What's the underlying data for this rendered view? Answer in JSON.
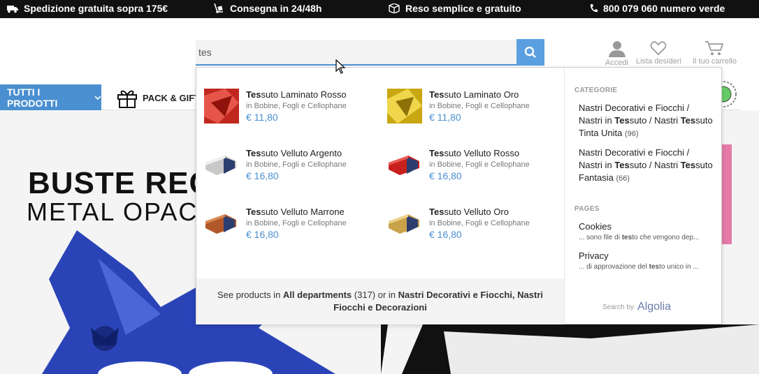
{
  "topbar": {
    "shipping": "Spedizione gratuita sopra 175€",
    "delivery": "Consegna in 24/48h",
    "returns": "Reso semplice e gratuito",
    "phone": "800 079 060 numero verde"
  },
  "search": {
    "value": "tes"
  },
  "header": {
    "account": "Accedi",
    "wishlist": "Lista desideri",
    "cart": "Il tuo carrello"
  },
  "nav": {
    "all_products": "TUTTI I PRODOTTI",
    "pack_gift": "PACK & GIFT"
  },
  "hero": {
    "title1": "BUSTE REGA",
    "title2": "METAL OPACO"
  },
  "dropdown": {
    "products": [
      {
        "highlight": "Tes",
        "rest": "suto Laminato Rosso",
        "category": "in Bobine, Fogli e Cellophane",
        "price": "€ 11,80"
      },
      {
        "highlight": "Tes",
        "rest": "suto Laminato Oro",
        "category": "in Bobine, Fogli e Cellophane",
        "price": "€ 11,80"
      },
      {
        "highlight": "Tes",
        "rest": "suto Velluto Argento",
        "category": "in Bobine, Fogli e Cellophane",
        "price": "€ 16,80"
      },
      {
        "highlight": "Tes",
        "rest": "suto Velluto Rosso",
        "category": "in Bobine, Fogli e Cellophane",
        "price": "€ 16,80"
      },
      {
        "highlight": "Tes",
        "rest": "suto Velluto Marrone",
        "category": "in Bobine, Fogli e Cellophane",
        "price": "€ 16,80"
      },
      {
        "highlight": "Tes",
        "rest": "suto Velluto Oro",
        "category": "in Bobine, Fogli e Cellophane",
        "price": "€ 16,80"
      }
    ],
    "footer": {
      "prefix": "See products in ",
      "all_departments": "All departments",
      "count": " (317) or in ",
      "category": "Nastri Decorativi e Fiocchi, Nastri Fiocchi e Decorazioni"
    },
    "categories_header": "CATEGORIE",
    "categories": [
      {
        "pre": "Nastri Decorativi e Fiocchi / Nastri in ",
        "hl1": "Tes",
        "mid": "suto / Nastri ",
        "hl2": "Tes",
        "post": "suto Tinta Unita",
        "count": "(96)"
      },
      {
        "pre": "Nastri Decorativi e Fiocchi / Nastri in ",
        "hl1": "Tes",
        "mid": "suto / Nastri ",
        "hl2": "Tes",
        "post": "suto Fantasia",
        "count": "(66)"
      }
    ],
    "pages_header": "PAGES",
    "pages": [
      {
        "title": "Cookies",
        "snip_pre": "... sono file di ",
        "snip_hl": "tes",
        "snip_post": "to che vengono dep..."
      },
      {
        "title": "Privacy",
        "snip_pre": "... di approvazione del ",
        "snip_hl": "tes",
        "snip_post": "to unico in ..."
      }
    ],
    "search_by": "Search by",
    "algolia": "Algolia"
  },
  "colors": {
    "accent": "#4a8fd0",
    "topbar": "#111111"
  }
}
